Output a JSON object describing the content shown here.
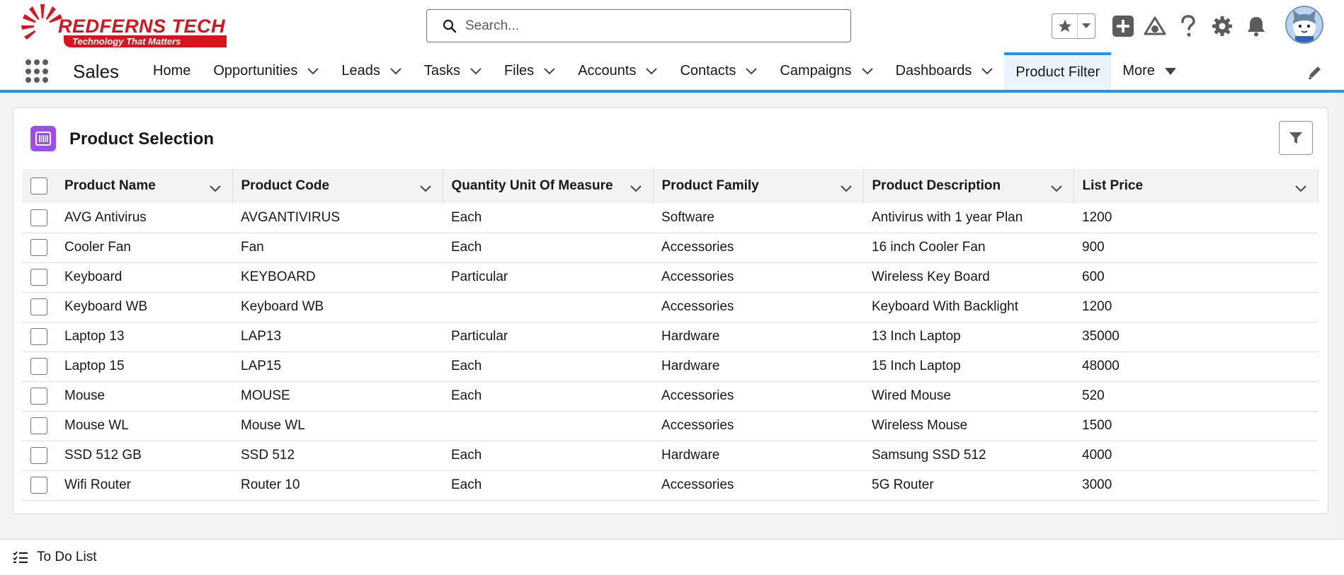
{
  "logo": {
    "word": "REDFERNS TECH",
    "tagline": "Technology That Matters",
    "color": "#d7141f"
  },
  "search": {
    "placeholder": "Search..."
  },
  "header_icons": [
    "favorite-star-icon",
    "add-icon",
    "trailhead-icon",
    "help-icon",
    "setup-gear-icon",
    "notification-bell-icon"
  ],
  "nav": {
    "app_name": "Sales",
    "items": [
      {
        "label": "Home",
        "has_menu": false
      },
      {
        "label": "Opportunities",
        "has_menu": true
      },
      {
        "label": "Leads",
        "has_menu": true
      },
      {
        "label": "Tasks",
        "has_menu": true
      },
      {
        "label": "Files",
        "has_menu": true
      },
      {
        "label": "Accounts",
        "has_menu": true
      },
      {
        "label": "Contacts",
        "has_menu": true
      },
      {
        "label": "Campaigns",
        "has_menu": true
      },
      {
        "label": "Dashboards",
        "has_menu": true
      },
      {
        "label": "Product Filter",
        "has_menu": false,
        "active": true
      },
      {
        "label": "More",
        "has_menu": true
      }
    ],
    "accent": "#1b96ff"
  },
  "card": {
    "title": "Product Selection",
    "icon": "product-barcode-icon",
    "icon_color": "#9c4ee6",
    "columns": [
      "Product Name",
      "Product Code",
      "Quantity Unit Of Measure",
      "Product Family",
      "Product Description",
      "List Price"
    ],
    "rows": [
      [
        "AVG Antivirus",
        "AVGANTIVIRUS",
        "Each",
        "Software",
        "Antivirus with 1 year Plan",
        "1200"
      ],
      [
        "Cooler Fan",
        "Fan",
        "Each",
        "Accessories",
        "16 inch Cooler Fan",
        "900"
      ],
      [
        "Keyboard",
        "KEYBOARD",
        "Particular",
        "Accessories",
        "Wireless Key Board",
        "600"
      ],
      [
        "Keyboard WB",
        "Keyboard WB",
        "",
        "Accessories",
        "Keyboard With Backlight",
        "1200"
      ],
      [
        "Laptop 13",
        "LAP13",
        "Particular",
        "Hardware",
        "13 Inch Laptop",
        "35000"
      ],
      [
        "Laptop 15",
        "LAP15",
        "Each",
        "Hardware",
        "15 Inch Laptop",
        "48000"
      ],
      [
        "Mouse",
        "MOUSE",
        "Each",
        "Accessories",
        "Wired Mouse",
        "520"
      ],
      [
        "Mouse WL",
        "Mouse WL",
        "",
        "Accessories",
        "Wireless Mouse",
        "1500"
      ],
      [
        "SSD 512 GB",
        "SSD 512",
        "Each",
        "Hardware",
        "Samsung SSD 512",
        "4000"
      ],
      [
        "Wifi Router",
        "Router 10",
        "Each",
        "Accessories",
        "5G Router",
        "3000"
      ]
    ]
  },
  "utility_bar": {
    "todo_label": "To Do List"
  }
}
